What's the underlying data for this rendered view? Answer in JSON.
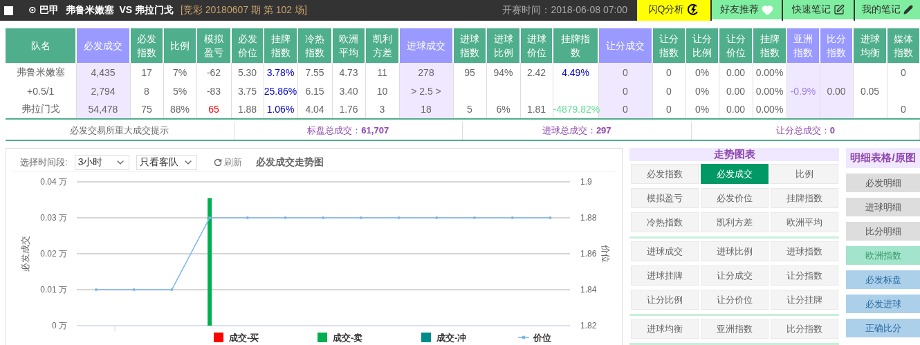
{
  "header": {
    "checkbox": {
      "checked": false
    },
    "league": "⊙ 巴甲",
    "match": "弗鲁米嫩塞  VS 弗拉门戈",
    "issue": "[竞彩 20180607 期 第 102 场]",
    "kickoff": "开赛时间：2018-06-08 07:00",
    "tabs": [
      {
        "label": "闪Q分析",
        "kind": "flash",
        "selected": true
      },
      {
        "label": "好友推荐",
        "kind": "heart",
        "selected": false
      },
      {
        "label": "快速笔记",
        "kind": "note",
        "selected": false
      },
      {
        "label": "我的笔记",
        "kind": "pencil",
        "selected": false
      }
    ]
  },
  "table": {
    "columns": [
      {
        "label": "队名",
        "kind": "plain"
      },
      {
        "label": "必发成交",
        "kind": "volume"
      },
      {
        "label": "必发指数",
        "kind": "plain"
      },
      {
        "label": "比例",
        "kind": "plain"
      },
      {
        "label": "模拟盈亏",
        "kind": "plain"
      },
      {
        "label": "必发价位",
        "kind": "plain"
      },
      {
        "label": "挂牌指数",
        "kind": "plain"
      },
      {
        "label": "冷热指数",
        "kind": "plain"
      },
      {
        "label": "欧洲平均",
        "kind": "plain"
      },
      {
        "label": "凯利方差",
        "kind": "plain"
      },
      {
        "label": "进球成交",
        "kind": "volume"
      },
      {
        "label": "进球指数",
        "kind": "plain"
      },
      {
        "label": "进球比例",
        "kind": "plain"
      },
      {
        "label": "进球价位",
        "kind": "plain"
      },
      {
        "label": "挂牌指数",
        "kind": "plain"
      },
      {
        "label": "让分成交",
        "kind": "volume"
      },
      {
        "label": "让分指数",
        "kind": "plain"
      },
      {
        "label": "让分比例",
        "kind": "plain"
      },
      {
        "label": "让分价位",
        "kind": "plain"
      },
      {
        "label": "挂牌指数",
        "kind": "plain"
      },
      {
        "label": "亚洲指数",
        "kind": "volume"
      },
      {
        "label": "比分指数",
        "kind": "volume"
      },
      {
        "label": "进球均衡",
        "kind": "plain"
      },
      {
        "label": "媒体指数",
        "kind": "plain"
      }
    ],
    "rows": [
      {
        "cells": [
          "弗鲁米嫩塞",
          "4,435",
          "17",
          "7%",
          "-62",
          "5.30",
          {
            "text": "3.78%",
            "color": "#0000cc"
          },
          "7.55",
          "4.73",
          "11",
          "278",
          "95",
          "94%",
          "2.42",
          {
            "text": "4.49%",
            "color": "#0000cc"
          },
          "0",
          "0",
          "0%",
          "0.00",
          "0.00%",
          null,
          null,
          null,
          "0"
        ]
      },
      {
        "cells": [
          "+0.5/1",
          "2,794",
          "8",
          "5%",
          "-83",
          "3.75",
          {
            "text": "25.86%",
            "color": "#0000cc"
          },
          "6.15",
          "3.40",
          "10",
          "> 2.5 >",
          null,
          null,
          null,
          null,
          "0",
          "0",
          "0%",
          "0.00",
          "0.00%",
          {
            "text": "-0.9%",
            "color": "#9b7fe8"
          },
          "0.00",
          "0.05",
          null
        ]
      },
      {
        "cells": [
          "弗拉门戈",
          "54,478",
          "75",
          "88%",
          {
            "text": "65",
            "color": "#ff0000"
          },
          "1.88",
          {
            "text": "1.06%",
            "color": "#0000cc"
          },
          "4.04",
          "1.76",
          "3",
          "18",
          "5",
          "6%",
          "1.81",
          {
            "text": "-4879.82%",
            "color": "#66dd99"
          },
          "0",
          "0",
          "0%",
          "0.00",
          "0.00%",
          null,
          null,
          null,
          "0"
        ]
      }
    ]
  },
  "summary": [
    {
      "label": "必发交易所重大成交提示"
    },
    {
      "label": "标盘总成交：",
      "value": "61,707"
    },
    {
      "label": "进球总成交：",
      "value": "297"
    },
    {
      "label": "让分总成交：",
      "value": "0"
    }
  ],
  "chart_panel": {
    "period_label": "选择时间段:",
    "period": "3小时",
    "filter": "只看客队",
    "refresh": "刷新",
    "title": "必发成交走势图",
    "chart_data": {
      "type": "bar",
      "ylabel": "必发成交",
      "y2label": "价位",
      "grid": true,
      "legend": "bottom",
      "ylim": [
        0,
        0.04
      ],
      "y2lim": [
        1.82,
        1.9
      ],
      "yticks": [
        {
          "value": 0,
          "label": "0 万"
        },
        {
          "value": 0.01,
          "label": "0.01 万"
        },
        {
          "value": 0.02,
          "label": "0.02 万"
        },
        {
          "value": 0.03,
          "label": "0.03 万"
        },
        {
          "value": 0.04,
          "label": "0.04 万"
        }
      ],
      "y2ticks": [
        {
          "value": 1.82,
          "label": "1.82"
        },
        {
          "value": 1.84,
          "label": "1.84"
        },
        {
          "value": 1.86,
          "label": "1.86"
        },
        {
          "value": 1.88,
          "label": "1.88"
        },
        {
          "value": 1.9,
          "label": "1.9"
        }
      ],
      "series": [
        {
          "name": "成交-买",
          "color": "#ff0000",
          "values": [
            null,
            null,
            null,
            null,
            null,
            null,
            null,
            null,
            null,
            null,
            null,
            null,
            null
          ]
        },
        {
          "name": "成交-卖",
          "color": "#00b050",
          "values": [
            null,
            null,
            null,
            0.0355,
            null,
            null,
            null,
            null,
            null,
            null,
            null,
            null,
            null
          ]
        },
        {
          "name": "成交-冲",
          "color": "#008b8b",
          "values": [
            null,
            null,
            null,
            null,
            null,
            null,
            null,
            null,
            null,
            null,
            null,
            null,
            null
          ]
        },
        {
          "name": "价位",
          "color": "#7cb5ec",
          "type": "line",
          "axis": "y2",
          "values": [
            1.84,
            1.84,
            1.84,
            1.88,
            1.88,
            1.88,
            1.88,
            1.88,
            1.88,
            1.88,
            1.88,
            1.88,
            1.88
          ]
        }
      ]
    }
  },
  "trend": {
    "title": "走势图表",
    "groups": [
      [
        {
          "label": "必发指数",
          "selected": false
        },
        {
          "label": "必发成交",
          "selected": true
        },
        {
          "label": "比例",
          "selected": false
        },
        {
          "label": "模拟盈亏",
          "selected": false
        },
        {
          "label": "必发价位",
          "selected": false
        },
        {
          "label": "挂牌指数",
          "selected": false
        },
        {
          "label": "冷热指数",
          "selected": false
        },
        {
          "label": "凯利方差",
          "selected": false
        },
        {
          "label": "欧洲平均",
          "selected": false
        }
      ],
      [
        {
          "label": "进球成交",
          "selected": false
        },
        {
          "label": "进球比例",
          "selected": false
        },
        {
          "label": "进球指数",
          "selected": false
        },
        {
          "label": "进球挂牌",
          "selected": false
        },
        {
          "label": "让分成交",
          "selected": false
        },
        {
          "label": "让分指数",
          "selected": false
        },
        {
          "label": "让分比例",
          "selected": false
        },
        {
          "label": "让分价位",
          "selected": false
        },
        {
          "label": "让分挂牌",
          "selected": false
        }
      ],
      [
        {
          "label": "进球均衡",
          "selected": false
        },
        {
          "label": "亚洲指数",
          "selected": false
        },
        {
          "label": "比分指数",
          "selected": false
        }
      ]
    ]
  },
  "details": {
    "title": "明细表格/原图",
    "links": [
      {
        "label": "必发明细",
        "kind": "grey"
      },
      {
        "label": "进球明细",
        "kind": "grey"
      },
      {
        "label": "比分明细",
        "kind": "grey"
      },
      {
        "label": "欧洲指数",
        "kind": "green"
      },
      {
        "label": "必发标盘",
        "kind": "blue"
      },
      {
        "label": "必发进球",
        "kind": "blue"
      },
      {
        "label": "正确比分",
        "kind": "blue"
      }
    ]
  }
}
